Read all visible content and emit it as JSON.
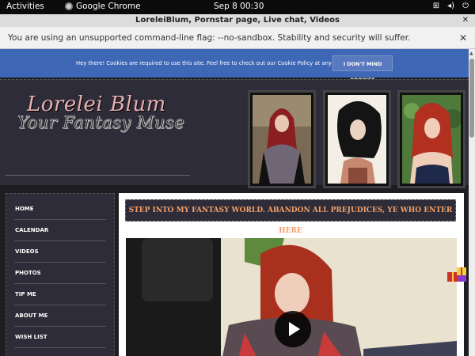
{
  "topbar": {
    "activities": "Activities",
    "app_name": "Google Chrome",
    "clock": "Sep 8  00:30"
  },
  "window": {
    "title": "LoreleiBlum, Pornstar page, Live chat, Videos"
  },
  "infobar": {
    "message": "You are using an unsupported command-line flag: --no-sandbox. Stability and security will suffer."
  },
  "cookie": {
    "message": "Hey there! Cookies are required to use this site. Feel free to check out our Cookie Policy at any time.",
    "button": "I DON'T MIND COOKIES"
  },
  "header": {
    "name": "Lorelei Blum",
    "tagline": "Your Fantasy Muse"
  },
  "nav": {
    "items": [
      "HOME",
      "CALENDAR",
      "VIDEOS",
      "PHOTOS",
      "TIP ME",
      "ABOUT ME",
      "WISH LIST"
    ]
  },
  "main": {
    "banner": "STEP INTO MY FANTASY WORLD. ABANDON ALL PREJUDICES, YE WHO ENTER HERE"
  },
  "colors": {
    "cookie_bg": "#3e67b6",
    "header_bg": "#2d2c38",
    "banner_text": "#f2a06a",
    "logo_name": "#e8b0b0"
  }
}
